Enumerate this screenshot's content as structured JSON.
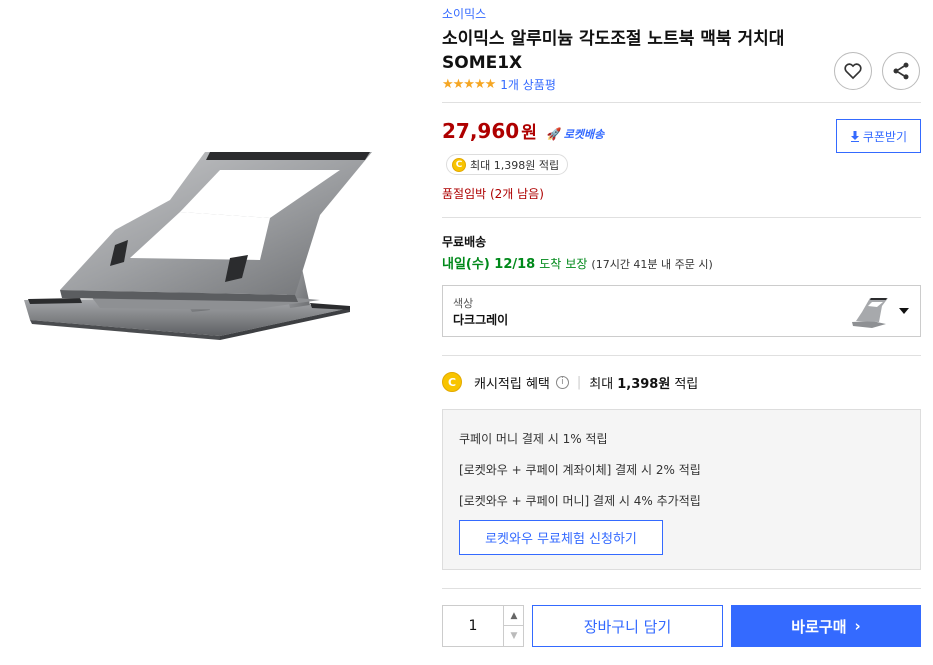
{
  "product": {
    "brand": "소이믹스",
    "title": "소이믹스 알루미늄 각도조절 노트북 맥북 거치대 SOME1X",
    "rating_stars": "★★★★★",
    "review_count": "1개 상품평",
    "image_icon": "laptop-stand-image"
  },
  "price": {
    "value": "27,960",
    "unit": "원",
    "rocket_label": "로켓배송",
    "rocket_icon": "rocket-icon",
    "coupon_label": "쿠폰받기",
    "cash_pill": "최대 1,398원 적립",
    "coin_symbol": "C",
    "stock_warning": "품절임박 (2개 남음)"
  },
  "shipping": {
    "label": "무료배송",
    "date": "내일(수) 12/18",
    "arrival": "도착",
    "guarantee": "보장",
    "note": "(17시간 41분 내 주문 시)"
  },
  "option": {
    "label": "색상",
    "value": "다크그레이"
  },
  "cash_benefit": {
    "label": "캐시적립 혜택",
    "info_symbol": "i",
    "separator": "|",
    "max_prefix": "최대",
    "max_amount": "1,398원",
    "max_suffix": "적립",
    "lines": [
      "쿠페이 머니 결제 시 1% 적립",
      "[로켓와우 + 쿠페이 계좌이체] 결제 시 2% 적립",
      "[로켓와우 + 쿠페이 머니] 결제 시 4% 추가적립"
    ],
    "rocketwow_button": "로켓와우 무료체험 신청하기"
  },
  "purchase": {
    "quantity": "1",
    "up_symbol": "▲",
    "down_symbol": "▼",
    "cart_label": "장바구니 담기",
    "buy_label": "바로구매",
    "buy_chevron": "›"
  },
  "colors": {
    "accent": "#346aff",
    "price": "#ae0000",
    "delivery": "#00891a",
    "star": "#f5a623"
  }
}
